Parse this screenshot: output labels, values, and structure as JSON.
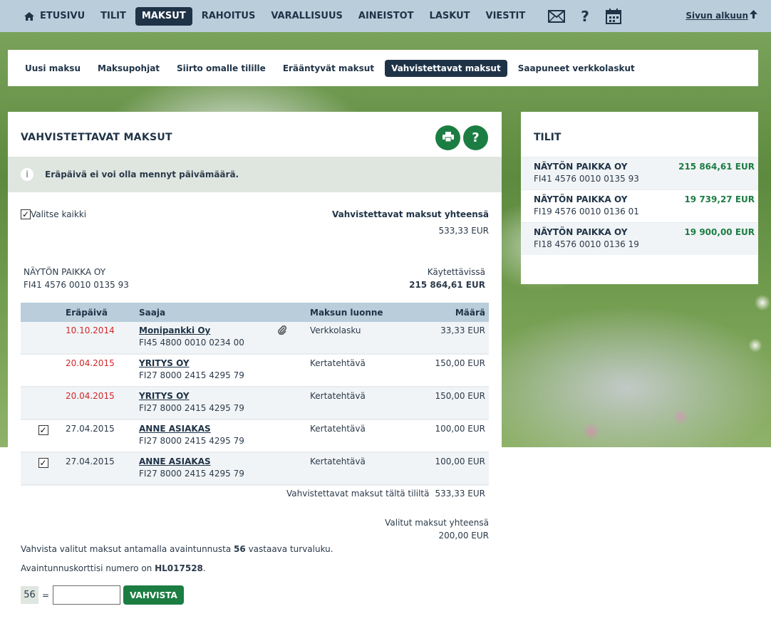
{
  "top_nav": {
    "items": [
      "ETUSIVU",
      "TILIT",
      "MAKSUT",
      "RAHOITUS",
      "VARALLISUUS",
      "AINEISTOT",
      "LASKUT",
      "VIESTIT"
    ],
    "top_link": "Sivun alkuun"
  },
  "sub_nav": {
    "items": [
      "Uusi maksu",
      "Maksupohjat",
      "Siirto omalle tilille",
      "Erääntyvät maksut",
      "Vahvistettavat maksut",
      "Saapuneet verkkolaskut"
    ]
  },
  "main": {
    "title": "VAHVISTETTAVAT MAKSUT",
    "notice": "Eräpäivä ei voi olla mennyt päivämäärä.",
    "select_all": "Valitse kaikki",
    "total_label": "Vahvistettavat maksut yhteensä",
    "total_value": "533,33 EUR",
    "account": {
      "name": "NÄYTÖN PAIKKA OY",
      "iban": "FI41 4576 0010 0135 93",
      "available_label": "Käytettävissä",
      "available_value": "215 864,61 EUR"
    },
    "table": {
      "headers": {
        "date": "Eräpäivä",
        "payee": "Saaja",
        "type": "Maksun luonne",
        "amount": "Määrä"
      },
      "rows": [
        {
          "checked": false,
          "date": "10.10.2014",
          "overdue": true,
          "payee": "Monipankki Oy",
          "iban": "FI45 4800 0010 0234 00",
          "attachment": true,
          "type": "Verkkolasku",
          "amount": "33,33 EUR"
        },
        {
          "checked": false,
          "date": "20.04.2015",
          "overdue": true,
          "payee": "YRITYS OY",
          "iban": "FI27 8000 2415 4295 79",
          "attachment": false,
          "type": "Kertatehtävä",
          "amount": "150,00 EUR"
        },
        {
          "checked": false,
          "date": "20.04.2015",
          "overdue": true,
          "payee": "YRITYS OY",
          "iban": "FI27 8000 2415 4295 79",
          "attachment": false,
          "type": "Kertatehtävä",
          "amount": "150,00 EUR"
        },
        {
          "checked": true,
          "date": "27.04.2015",
          "overdue": false,
          "payee": "ANNE ASIAKAS",
          "iban": "FI27 8000 2415 4295 79",
          "attachment": false,
          "type": "Kertatehtävä",
          "amount": "100,00 EUR"
        },
        {
          "checked": true,
          "date": "27.04.2015",
          "overdue": false,
          "payee": "ANNE ASIAKAS",
          "iban": "FI27 8000 2415 4295 79",
          "attachment": false,
          "type": "Kertatehtävä",
          "amount": "100,00 EUR"
        }
      ],
      "subtotal_label": "Vahvistettavat maksut tältä tililtä",
      "subtotal_value": "533,33 EUR"
    },
    "selected_label": "Valitut maksut yhteensä",
    "selected_value": "200,00 EUR",
    "instruction1_pre": "Vahvista valitut maksut antamalla avaintunnusta",
    "instruction1_num": "56",
    "instruction1_post": "vastaava turvaluku.",
    "instruction2_pre": "Avaintunnuskorttisi numero on",
    "instruction2_card": "HL017528",
    "instruction2_post": ".",
    "code_number": "56",
    "equals": "=",
    "confirm_button": "VAHVISTA"
  },
  "side": {
    "title": "TILIT",
    "accounts": [
      {
        "name": "NÄYTÖN PAIKKA OY",
        "iban": "FI41 4576 0010 0135 93",
        "balance": "215 864,61 EUR"
      },
      {
        "name": "NÄYTÖN PAIKKA OY",
        "iban": "FI19 4576 0010 0136 01",
        "balance": "19 739,27 EUR"
      },
      {
        "name": "NÄYTÖN PAIKKA OY",
        "iban": "FI18 4576 0010 0136 19",
        "balance": "19 900,00 EUR"
      }
    ]
  },
  "colors": {
    "accent_green": "#1c7d43",
    "nav_dark": "#1f3347",
    "nav_bg": "#b9cddb",
    "overdue_red": "#d0262b"
  },
  "icons": [
    "home-icon",
    "mail-icon",
    "help-icon",
    "calendar-icon",
    "arrow-up-icon",
    "print-icon",
    "info-icon",
    "paperclip-icon",
    "checkbox-icon"
  ]
}
